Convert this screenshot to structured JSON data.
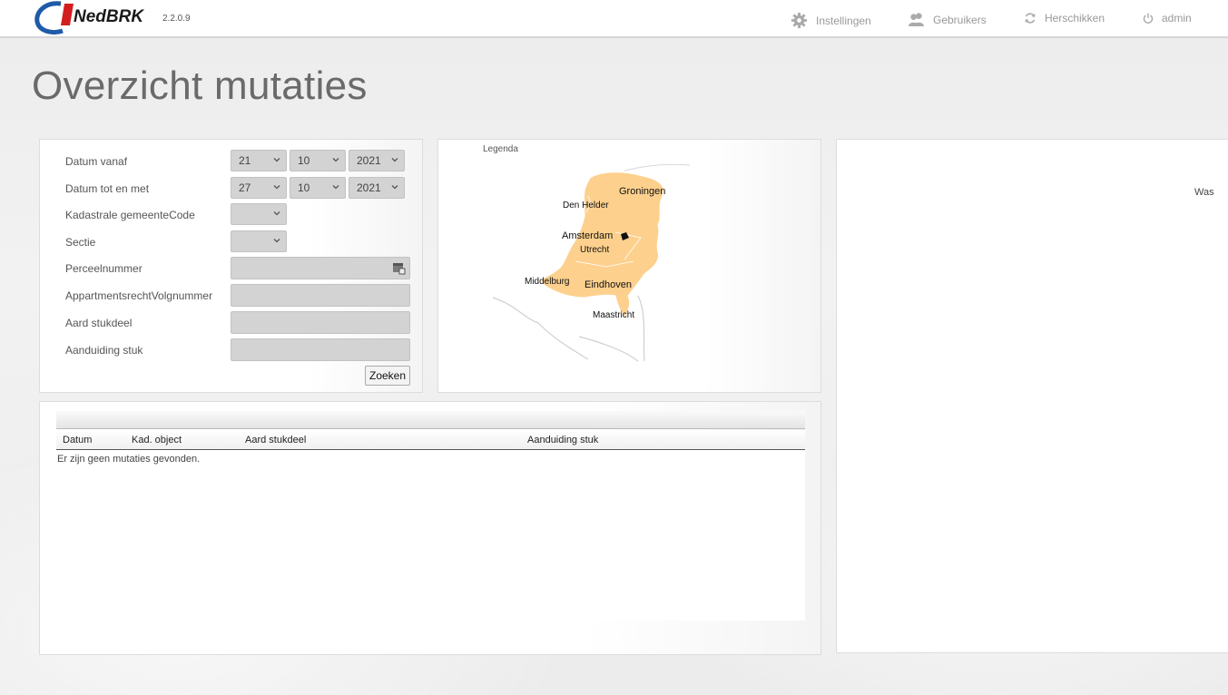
{
  "header": {
    "logo_text": "NedBRK",
    "version": "2.2.0.9",
    "nav": [
      {
        "label": "Instellingen",
        "icon": "gear-icon"
      },
      {
        "label": "Gebruikers",
        "icon": "users-icon"
      },
      {
        "label": "Herschikken",
        "icon": "refresh-icon"
      },
      {
        "label": "admin",
        "icon": "power-icon"
      }
    ]
  },
  "page": {
    "title": "Overzicht mutaties"
  },
  "form": {
    "datum_vanaf": {
      "label": "Datum vanaf",
      "day": "21",
      "month": "10",
      "year": "2021"
    },
    "datum_tot": {
      "label": "Datum tot en met",
      "day": "27",
      "month": "10",
      "year": "2021"
    },
    "gemeente": {
      "label": "Kadastrale gemeenteCode",
      "value": ""
    },
    "sectie": {
      "label": "Sectie",
      "value": ""
    },
    "perceel": {
      "label": "Perceelnummer",
      "value": ""
    },
    "appartement": {
      "label": "AppartmentsrechtVolgnummer",
      "value": ""
    },
    "aard": {
      "label": "Aard stukdeel",
      "value": ""
    },
    "aanduiding": {
      "label": "Aanduiding stuk",
      "value": ""
    },
    "search_button": "Zoeken"
  },
  "map": {
    "legend_label": "Legenda",
    "cities": [
      "Groningen",
      "Den Helder",
      "Amsterdam",
      "Utrecht",
      "Middelburg",
      "Eindhoven",
      "Maastricht"
    ],
    "fill_color": "#fdd08d"
  },
  "right": {
    "label": "Was"
  },
  "results": {
    "columns": [
      "Datum",
      "Kad. object",
      "Aard stukdeel",
      "Aanduiding stuk"
    ],
    "empty_message": "Er zijn geen mutaties gevonden."
  }
}
